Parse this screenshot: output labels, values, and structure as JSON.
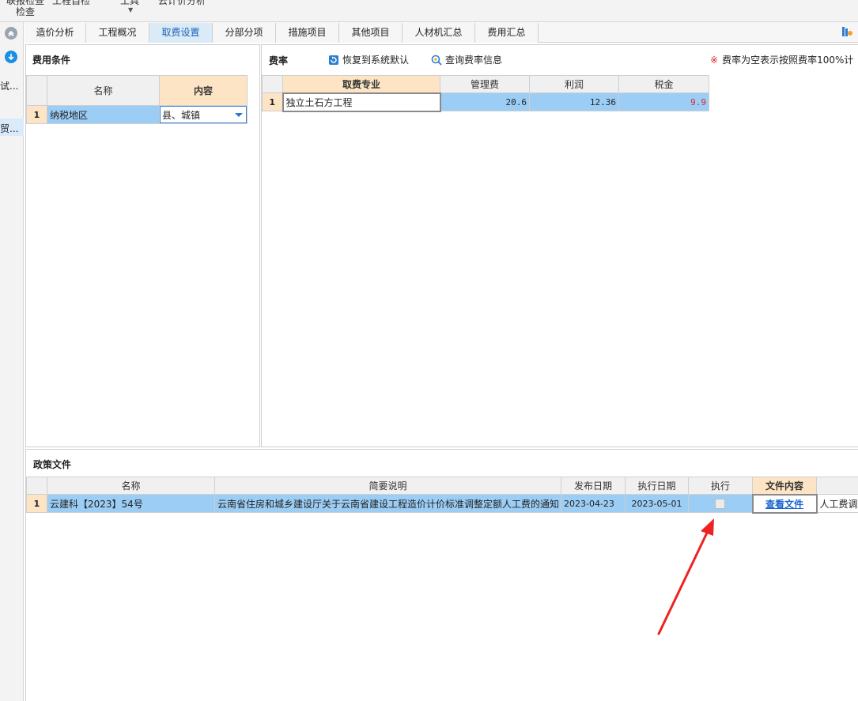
{
  "toolbar": {
    "fragment_1": "联报检查",
    "fragment_2": "工程自检",
    "fragment_3": "工具",
    "fragment_4": "云计价分析",
    "check_label": "检查"
  },
  "rail": {
    "item_1": "试...",
    "item_2": "贸..."
  },
  "tabs": [
    {
      "label": "造价分析"
    },
    {
      "label": "工程概况"
    },
    {
      "label": "取费设置"
    },
    {
      "label": "分部分项"
    },
    {
      "label": "措施项目"
    },
    {
      "label": "其他项目"
    },
    {
      "label": "人材机汇总"
    },
    {
      "label": "费用汇总"
    }
  ],
  "fee_conditions": {
    "title": "费用条件",
    "headers": {
      "name": "名称",
      "content": "内容"
    },
    "rows": [
      {
        "index": "1",
        "name": "纳税地区",
        "content": "县、城镇"
      }
    ]
  },
  "rates": {
    "title": "费率",
    "restore_label": "恢复到系统默认",
    "query_label": "查询费率信息",
    "note": "费率为空表示按照费率100%计",
    "note_mark": "※",
    "headers": {
      "specialty": "取费专业",
      "mgmt": "管理费",
      "profit": "利润",
      "tax": "税金"
    },
    "rows": [
      {
        "index": "1",
        "specialty": "独立土石方工程",
        "mgmt": "20.6",
        "profit": "12.36",
        "tax": "9.9"
      }
    ],
    "colors": {
      "tax_value": "#e0242d"
    }
  },
  "policy": {
    "title": "政策文件",
    "headers": {
      "name": "名称",
      "desc": "简要说明",
      "publish": "发布日期",
      "execute_date": "执行日期",
      "execute": "执行",
      "content": "文件内容"
    },
    "rows": [
      {
        "index": "1",
        "name": "云建科【2023】54号",
        "desc": "云南省住房和城乡建设厅关于云南省建设工程造价计价标准调整定额人工费的通知",
        "publish": "2023-04-23",
        "execute_date": "2023-05-01",
        "execute_checked": false,
        "content_link": "查看文件",
        "extra": "人工费调整"
      }
    ]
  },
  "colors": {
    "accent": "#1a64b8",
    "active_tab": "#dbeaf7",
    "selected_row": "#9ccdf5",
    "header_highlight": "#fde4c4",
    "annotation_arrow": "#ee2222"
  }
}
